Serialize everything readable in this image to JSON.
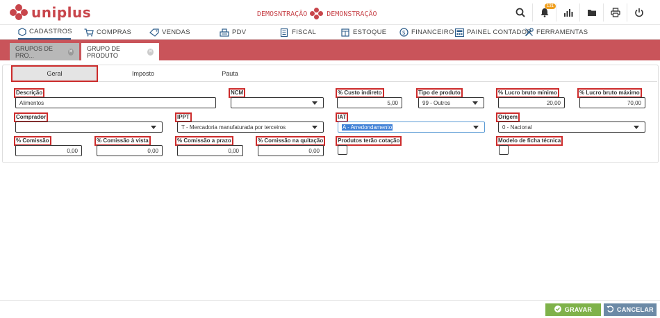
{
  "brand": {
    "name": "uniplus",
    "color": "#c8454b"
  },
  "header": {
    "company_left": "DEMOSNTRAÇÃO",
    "company_right": "DEMONSTRAÇÃO",
    "notification_count": "131",
    "icons": [
      "search-icon",
      "bell-icon",
      "bar-chart-icon",
      "folder-icon",
      "print-icon",
      "power-icon"
    ]
  },
  "menu": {
    "items": [
      {
        "label": "CADASTROS",
        "icon": "hexagon-icon"
      },
      {
        "label": "COMPRAS",
        "icon": "cart-icon"
      },
      {
        "label": "VENDAS",
        "icon": "tag-icon"
      },
      {
        "label": "PDV",
        "icon": "register-icon"
      },
      {
        "label": "FISCAL",
        "icon": "document-icon"
      },
      {
        "label": "ESTOQUE",
        "icon": "box-icon"
      },
      {
        "label": "FINANCEIRO",
        "icon": "dollar-icon"
      },
      {
        "label": "PAINEL CONTADOR",
        "icon": "calculator-icon"
      },
      {
        "label": "FERRAMENTAS",
        "icon": "tools-icon"
      }
    ]
  },
  "tabs": [
    {
      "label": "GRUPOS DE PRO..."
    },
    {
      "label": "GRUPO DE PRODUTO"
    }
  ],
  "subtabs": [
    "Geral",
    "Imposto",
    "Pauta"
  ],
  "form": {
    "descricao": {
      "label": "Descrição",
      "value": "Alimentos"
    },
    "ncm": {
      "label": "NCM",
      "value": ""
    },
    "custo_indireto": {
      "label": "% Custo indireto",
      "value": "5,00"
    },
    "tipo_produto": {
      "label": "Tipo de produto",
      "value": "99 - Outros"
    },
    "lucro_min": {
      "label": "% Lucro bruto mínimo",
      "value": "20,00"
    },
    "lucro_max": {
      "label": "% Lucro bruto máximo",
      "value": "70,00"
    },
    "comprador": {
      "label": "Comprador",
      "value": ""
    },
    "ippt": {
      "label": "IPPT",
      "value": "T - Mercadoria manufaturada por terceiros"
    },
    "iat": {
      "label": "IAT",
      "value": "A - Arredondamento"
    },
    "origem": {
      "label": "Origem",
      "value": "0 - Nacional"
    },
    "comissao": {
      "label": "% Comissão",
      "value": "0,00"
    },
    "comissao_vista": {
      "label": "% Comissão à vista",
      "value": "0,00"
    },
    "comissao_prazo": {
      "label": "% Comissão a prazo",
      "value": "0,00"
    },
    "comissao_quitacao": {
      "label": "% Comissão na quitação",
      "value": "0,00"
    },
    "cotacao": {
      "label": "Produtos terão cotação",
      "checked": false
    },
    "ficha": {
      "label": "Modelo de ficha técnica",
      "checked": false
    }
  },
  "footer": {
    "save": "GRAVAR",
    "cancel": "CANCELAR"
  }
}
